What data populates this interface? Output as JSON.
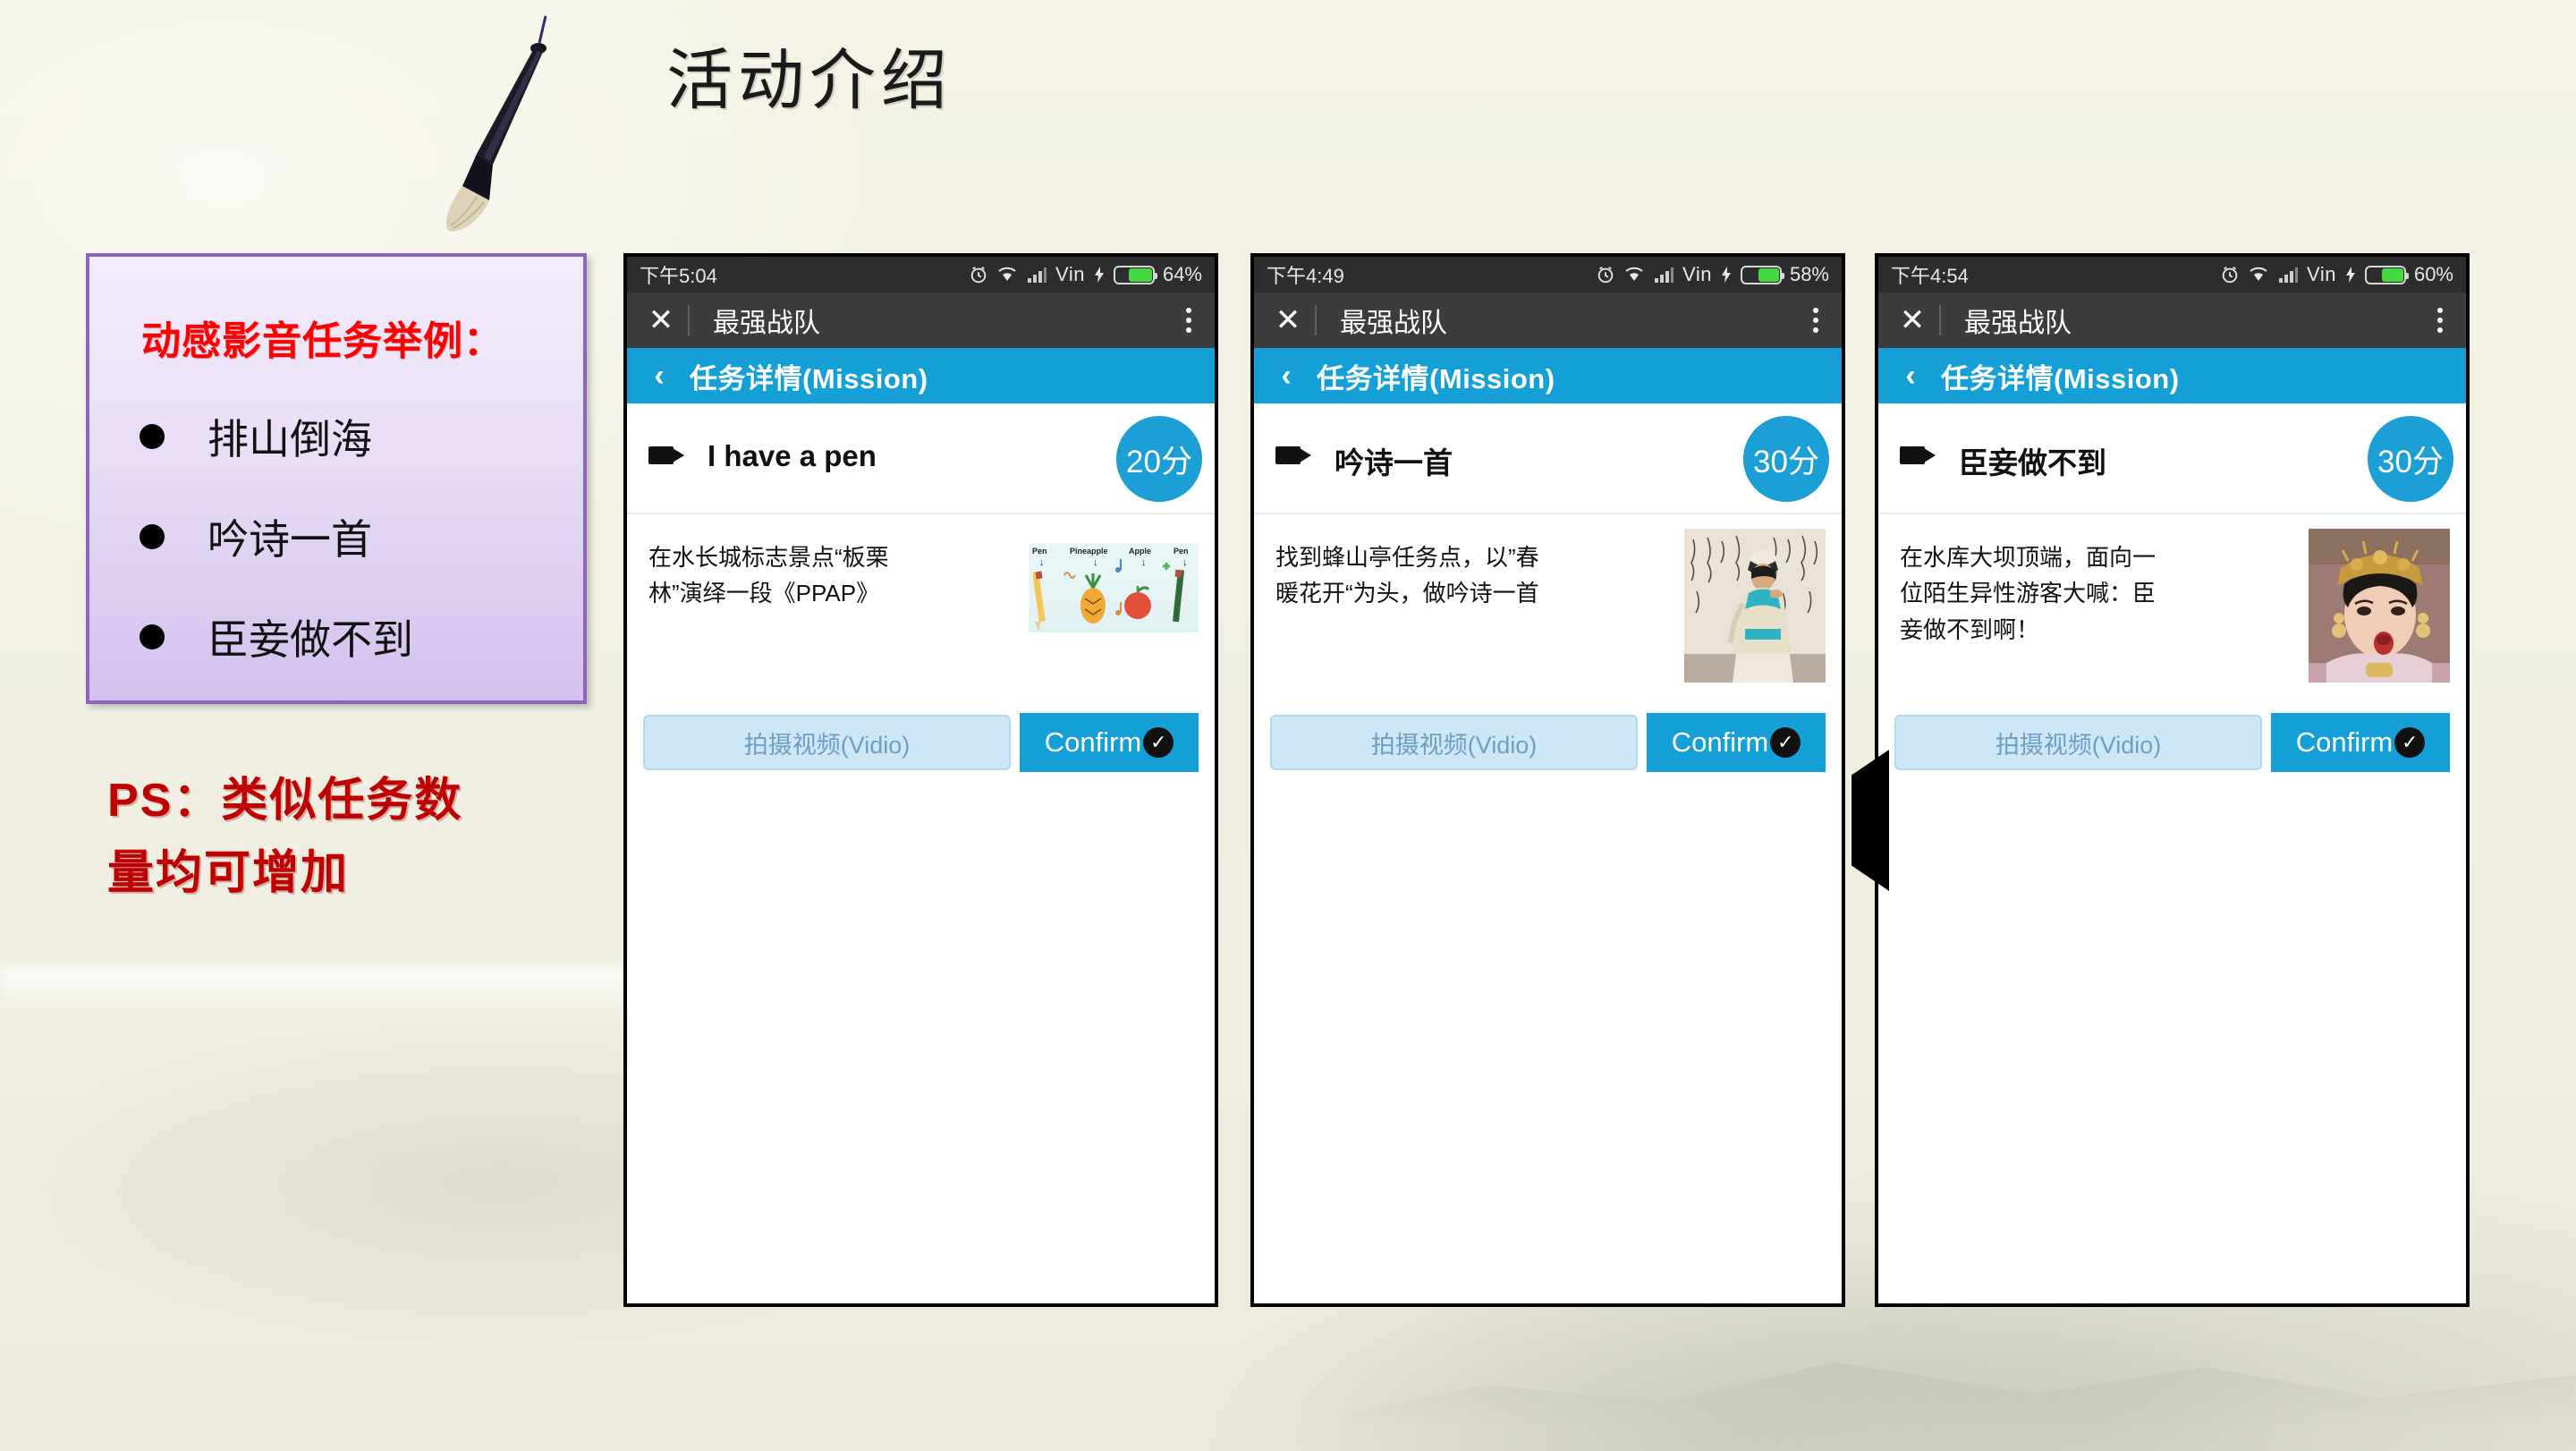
{
  "slide": {
    "title": "活动介绍",
    "background_color": "#f0efe0",
    "accent_blue": "#14a0d7",
    "accent_red": "#c00000"
  },
  "callout": {
    "heading": "动感影音任务举例：",
    "heading_color": "#ff0000",
    "items": [
      {
        "label": "排山倒海"
      },
      {
        "label": "吟诗一首"
      },
      {
        "label": "臣妾做不到"
      }
    ]
  },
  "ps_note": {
    "line1": "PS：类似任务数",
    "line2": "量均可增加"
  },
  "phones": [
    {
      "status": {
        "time": "下午5:04",
        "alarm_icon": "alarm-clock-icon",
        "wifi_icon": "wifi-icon",
        "signal_icon": "cell-signal-icon",
        "carrier": "Vin",
        "charging_icon": "lightning-bolt-icon",
        "battery_percent": "64%",
        "battery_level": 64
      },
      "appbar": {
        "close_icon": "close-icon",
        "title": "最强战队",
        "menu_icon": "overflow-menu-icon"
      },
      "navbar": {
        "back_icon": "chevron-left-icon",
        "title": "任务详情(Mission)"
      },
      "task": {
        "video_icon": "video-camera-icon",
        "title": "I have a pen",
        "score": "20分",
        "description": "在水长城标志景点“板栗林”演绎一段《PPAP》",
        "image_name": "ppap-pen-pineapple-apple-illustration",
        "image_labels": [
          "Pen",
          "Pineapple",
          "Apple",
          "Pen"
        ]
      },
      "buttons": {
        "video_label": "拍摄视频(Vidio)",
        "confirm_label": "Confirm",
        "confirm_check_icon": "check-circle-icon"
      }
    },
    {
      "status": {
        "time": "下午4:49",
        "alarm_icon": "alarm-clock-icon",
        "wifi_icon": "wifi-icon",
        "signal_icon": "cell-signal-icon",
        "carrier": "Vin",
        "charging_icon": "lightning-bolt-icon",
        "battery_percent": "58%",
        "battery_level": 58
      },
      "appbar": {
        "close_icon": "close-icon",
        "title": "最强战队",
        "menu_icon": "overflow-menu-icon"
      },
      "navbar": {
        "back_icon": "chevron-left-icon",
        "title": "任务详情(Mission)"
      },
      "task": {
        "video_icon": "video-camera-icon",
        "title": "吟诗一首",
        "score": "30分",
        "description": "找到蜂山亭任务点，以”春暖花开“为头，做吟诗一首",
        "image_name": "scholar-in-robe-calligraphy-wall-photo"
      },
      "buttons": {
        "video_label": "拍摄视频(Vidio)",
        "confirm_label": "Confirm",
        "confirm_check_icon": "check-circle-icon"
      }
    },
    {
      "status": {
        "time": "下午4:54",
        "alarm_icon": "alarm-clock-icon",
        "wifi_icon": "wifi-icon",
        "signal_icon": "cell-signal-icon",
        "carrier": "Vin",
        "charging_icon": "lightning-bolt-icon",
        "battery_percent": "60%",
        "battery_level": 60
      },
      "appbar": {
        "close_icon": "close-icon",
        "title": "最强战队",
        "menu_icon": "overflow-menu-icon"
      },
      "navbar": {
        "back_icon": "chevron-left-icon",
        "title": "任务详情(Mission)"
      },
      "task": {
        "video_icon": "video-camera-icon",
        "title": "臣妾做不到",
        "score": "30分",
        "description": "在水库大坝顶端，面向一位陌生异性游客大喊：臣妾做不到啊！",
        "image_name": "qing-dynasty-empress-meme-photo"
      },
      "buttons": {
        "video_label": "拍摄视频(Vidio)",
        "confirm_label": "Confirm",
        "confirm_check_icon": "check-circle-icon"
      }
    }
  ]
}
